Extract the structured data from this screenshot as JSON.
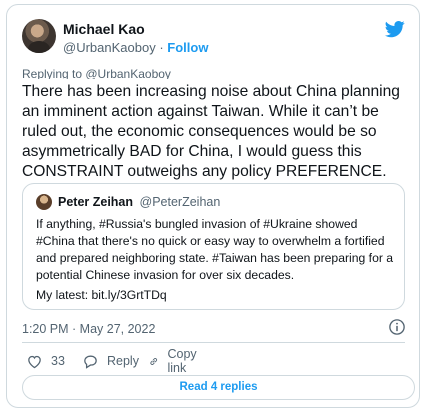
{
  "author": {
    "name": "Michael Kao",
    "handle": "@UrbanKaoboy",
    "separator": "·",
    "follow_label": "Follow"
  },
  "reply_context": "Replying to @UrbanKaoboy",
  "tweet_text": "There has been increasing noise about China planning an imminent action against Taiwan. While it can’t be ruled out, the economic consequences would be so asymmetrically BAD for China, I would guess this CONSTRAINT outweighs any policy PREFERENCE.",
  "quoted_tweet": {
    "name": "Peter Zeihan",
    "handle": "@PeterZeihan",
    "text": "If anything, #Russia's bungled invasion of #Ukraine showed #China that there's no quick or easy way to overwhelm a fortified and prepared neighboring state. #Taiwan has been preparing for a potential Chinese invasion for over six decades.",
    "latest": "My latest: bit.ly/3GrtTDq"
  },
  "timestamp": "1:20 PM · May 27, 2022",
  "actions": {
    "like_count": "33",
    "reply_label": "Reply",
    "copy_link_label": "Copy link"
  },
  "read_replies_label": "Read 4 replies",
  "icons": [
    "twitter-bird-icon",
    "info-icon",
    "heart-icon",
    "reply-icon",
    "link-icon"
  ],
  "colors": {
    "accent": "#1d9bf0",
    "secondary_text": "#536471",
    "border": "#cfd9de"
  }
}
